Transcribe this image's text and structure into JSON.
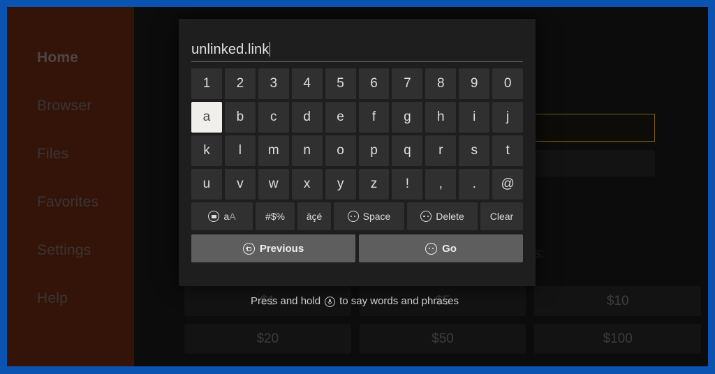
{
  "frame": {
    "border_color": "#0b53b0"
  },
  "sidebar": {
    "items": [
      {
        "label": "Home",
        "active": true
      },
      {
        "label": "Browser",
        "active": false
      },
      {
        "label": "Files",
        "active": false
      },
      {
        "label": "Favorites",
        "active": false
      },
      {
        "label": "Settings",
        "active": false
      },
      {
        "label": "Help",
        "active": false
      }
    ]
  },
  "background": {
    "url_field_border_color": "#7a5f10",
    "donate_heading": "ase donation buttons:",
    "donate_sub": ")",
    "donation_buttons_row1": [
      "$1",
      "$5",
      "$10"
    ],
    "donation_buttons_row2": [
      "$20",
      "$50",
      "$100"
    ],
    "voice_hint_prefix": "Press and hold",
    "voice_hint_suffix": "to say words and phrases",
    "voice_hint_icon": "microphone-icon"
  },
  "keyboard": {
    "input_value": "unlinked.link",
    "rows": [
      [
        "1",
        "2",
        "3",
        "4",
        "5",
        "6",
        "7",
        "8",
        "9",
        "0"
      ],
      [
        "a",
        "b",
        "c",
        "d",
        "e",
        "f",
        "g",
        "h",
        "i",
        "j"
      ],
      [
        "k",
        "l",
        "m",
        "n",
        "o",
        "p",
        "q",
        "r",
        "s",
        "t"
      ],
      [
        "u",
        "v",
        "w",
        "x",
        "y",
        "z",
        "!",
        ",",
        ".",
        "@"
      ]
    ],
    "selected_key": "a",
    "selected_key_bg": "#f0efeb",
    "function_keys": {
      "case_main": "a",
      "case_alt": "A",
      "case_icon": "remote-button-icon",
      "symbols": "#$%",
      "accents": "äçé",
      "space": "Space",
      "space_icon": "remote-menu-icon",
      "delete": "Delete",
      "delete_icon": "remote-menu-icon",
      "clear": "Clear"
    },
    "actions": {
      "previous": "Previous",
      "previous_icon": "remote-back-icon",
      "go": "Go",
      "go_icon": "remote-menu-icon"
    }
  }
}
